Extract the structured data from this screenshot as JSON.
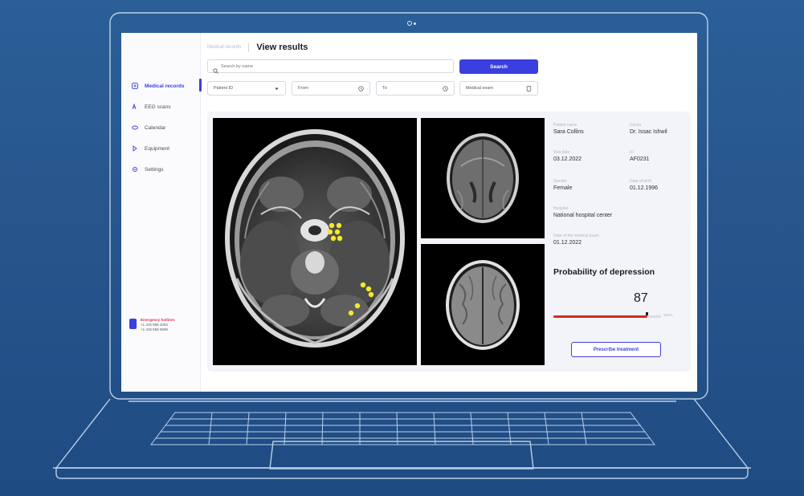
{
  "sidebar": {
    "items": [
      {
        "label": "Medical records",
        "icon": "records-icon",
        "active": true
      },
      {
        "label": "EEG scans",
        "icon": "eeg-icon",
        "active": false
      },
      {
        "label": "Calendar",
        "icon": "calendar-icon",
        "active": false
      },
      {
        "label": "Equipment",
        "icon": "equipment-icon",
        "active": false
      },
      {
        "label": "Settings",
        "icon": "gear-icon",
        "active": false
      }
    ],
    "emergency": {
      "title": "Emergency hotlines",
      "numbers": [
        "+1 415 555 1004",
        "+1 415 555 0609"
      ]
    }
  },
  "header": {
    "breadcrumb": "Medical records",
    "title": "View results"
  },
  "search": {
    "placeholder": "Search by name",
    "button_label": "Search"
  },
  "filters": {
    "patient_id": "Patient ID",
    "from": "From",
    "to": "To",
    "medical_exam": "Medical exam"
  },
  "patient": {
    "name_label": "Patient name",
    "name": "Sara Collins",
    "doctor_label": "Doctor",
    "doctor": "Dr. Issac Ishwil",
    "visit_date_label": "Visit date",
    "visit_date": "03.12.2022",
    "id_label": "ID",
    "id": "AF0231",
    "gender_label": "Gender",
    "gender": "Female",
    "dob_label": "Date of birth",
    "dob": "01.12.1996",
    "hospital_label": "Hospital",
    "hospital": "National hospital center",
    "exam_date_label": "Date of the medical exam",
    "exam_date": "01.12.2022"
  },
  "probability": {
    "title": "Probability of depression",
    "value": "87",
    "fraction": 0.87,
    "max_label": "100%"
  },
  "actions": {
    "prescribe": "Prescribe treatment"
  },
  "colors": {
    "accent": "#3b3fe0",
    "danger": "#d42b20",
    "background": "#27558c",
    "markers": "#f5e82a"
  }
}
